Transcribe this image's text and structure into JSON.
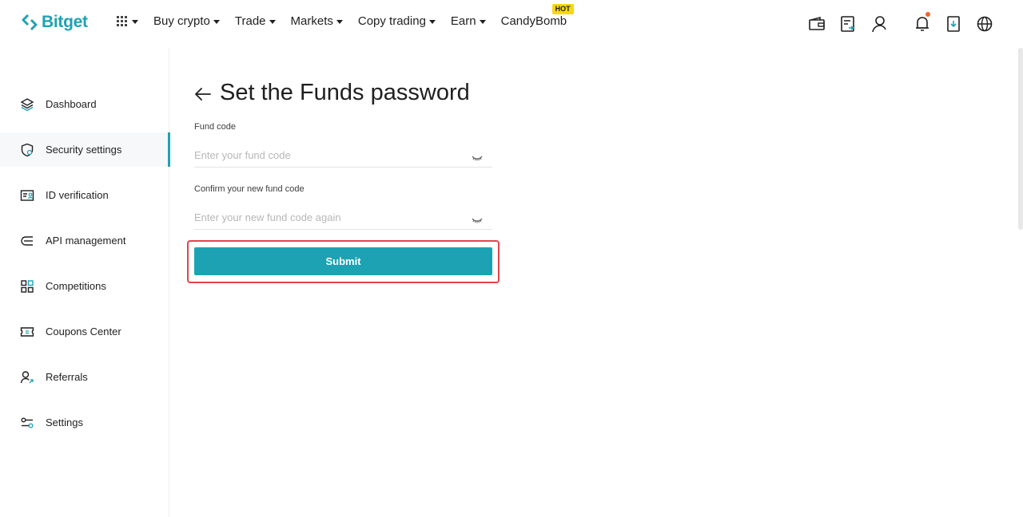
{
  "brand": {
    "name": "Bitget",
    "accent": "#1da2b4"
  },
  "nav": {
    "items": [
      {
        "label": "Buy crypto",
        "dropdown": true
      },
      {
        "label": "Trade",
        "dropdown": true
      },
      {
        "label": "Markets",
        "dropdown": true
      },
      {
        "label": "Copy trading",
        "dropdown": true
      },
      {
        "label": "Earn",
        "dropdown": true
      },
      {
        "label": "CandyBomb",
        "dropdown": false,
        "badge": "HOT"
      }
    ]
  },
  "header_icons": [
    "wallet-icon",
    "orders-icon",
    "user-icon",
    "bell-icon",
    "download-icon",
    "globe-icon"
  ],
  "sidebar": {
    "items": [
      {
        "label": "Dashboard",
        "icon": "layers-icon"
      },
      {
        "label": "Security settings",
        "icon": "shield-icon",
        "active": true
      },
      {
        "label": "ID verification",
        "icon": "id-card-icon"
      },
      {
        "label": "API management",
        "icon": "api-icon"
      },
      {
        "label": "Competitions",
        "icon": "grid-icon"
      },
      {
        "label": "Coupons Center",
        "icon": "ticket-icon"
      },
      {
        "label": "Referrals",
        "icon": "referral-icon"
      },
      {
        "label": "Settings",
        "icon": "settings-icon"
      }
    ]
  },
  "main": {
    "title": "Set the Funds password",
    "fund_code": {
      "label": "Fund code",
      "placeholder": "Enter your fund code",
      "value": ""
    },
    "confirm_code": {
      "label": "Confirm your new fund code",
      "placeholder": "Enter your new fund code again",
      "value": ""
    },
    "submit_label": "Submit"
  }
}
